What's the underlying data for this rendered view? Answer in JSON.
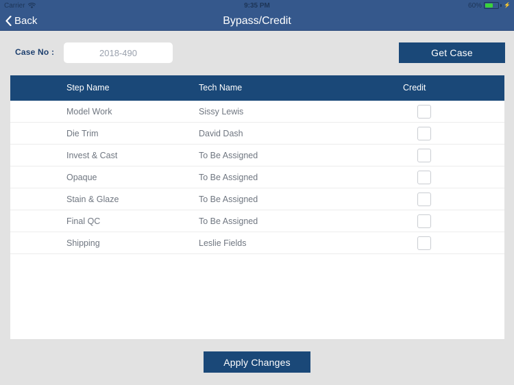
{
  "status_bar": {
    "carrier": "Carrier",
    "wifi_icon": "wifi-icon",
    "time": "9:35 PM",
    "battery_percent": "60%",
    "battery_level": 60,
    "battery_icon": "battery-icon",
    "charging_icon": "lightning-bolt-icon"
  },
  "nav": {
    "back_label": "Back",
    "back_icon": "chevron-left-icon",
    "title": "Bypass/Credit"
  },
  "toolbar": {
    "case_label": "Case No :",
    "case_value": "2018-490",
    "case_placeholder": "2018-490",
    "get_case_label": "Get Case"
  },
  "table": {
    "columns": [
      "Step Name",
      "Tech Name",
      "Credit"
    ],
    "rows": [
      {
        "step": "Model Work",
        "tech": "Sissy Lewis",
        "credit": false
      },
      {
        "step": "Die Trim",
        "tech": "David Dash",
        "credit": false
      },
      {
        "step": "Invest & Cast",
        "tech": "To Be Assigned",
        "credit": false
      },
      {
        "step": "Opaque",
        "tech": "To Be Assigned",
        "credit": false
      },
      {
        "step": "Stain & Glaze",
        "tech": "To Be Assigned",
        "credit": false
      },
      {
        "step": "Final QC",
        "tech": "To Be Assigned",
        "credit": false
      },
      {
        "step": "Shipping",
        "tech": "Leslie Fields",
        "credit": false
      }
    ]
  },
  "footer": {
    "apply_label": "Apply Changes"
  },
  "colors": {
    "nav_bar": "#35588c",
    "accent_navy": "#1a4878",
    "page_background": "#e2e2e2",
    "row_text": "#6f7680",
    "label_text": "#1d3f6e",
    "battery_green": "#3ad33a"
  }
}
